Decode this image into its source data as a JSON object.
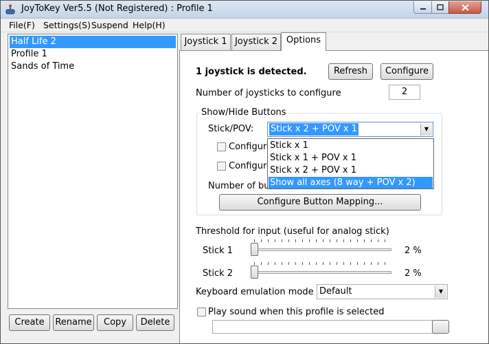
{
  "window": {
    "title": "JoyToKey Ver5.5 (Not Registered) : Profile 1"
  },
  "menubar": {
    "items": [
      "File(F)",
      "Settings(S)",
      "Suspend",
      "Help(H)"
    ]
  },
  "profiles": {
    "items": [
      "Half Life 2",
      "Profile 1",
      "Sands of Time"
    ],
    "selected_index": 0
  },
  "profile_buttons": {
    "create": "Create",
    "rename": "Rename",
    "copy": "Copy",
    "delete": "Delete"
  },
  "tabs": {
    "items": [
      "Joystick 1",
      "Joystick 2",
      "Options"
    ],
    "active": "Options"
  },
  "options": {
    "detected_text": "1 joystick is detected.",
    "refresh_label": "Refresh",
    "configure_label": "Configure",
    "num_joysticks_label": "Number of joysticks to configure",
    "num_joysticks_value": "2",
    "group_title": "Show/Hide Buttons",
    "stick_pov_label": "Stick/POV:",
    "stick_pov_value": "Stick x 2 + POV x 1",
    "configure_check1_label": "Configure",
    "configure_check2_label": "Configure",
    "number_of_buttons_label": "Number of bu",
    "configure_mapping_label": "Configure Button Mapping...",
    "threshold_label": "Threshold for input (useful for analog stick)",
    "stick1_label": "Stick 1",
    "stick1_value": "2 %",
    "stick1_level": 0.02,
    "stick2_label": "Stick 2",
    "stick2_value": "2 %",
    "stick2_level": 0.02,
    "keyboard_mode_label": "Keyboard emulation mode",
    "keyboard_mode_value": "Default",
    "play_sound_label": "Play sound when this profile is selected"
  },
  "dropdown": {
    "options": [
      "Stick x 1",
      "Stick x 1 + POV x 1",
      "Stick x 2 + POV x 1",
      "Show all axes (8 way + POV x 2)"
    ],
    "highlighted_index": 3
  },
  "colors": {
    "selection": "#3399ff",
    "close_button": "#c75a47"
  }
}
